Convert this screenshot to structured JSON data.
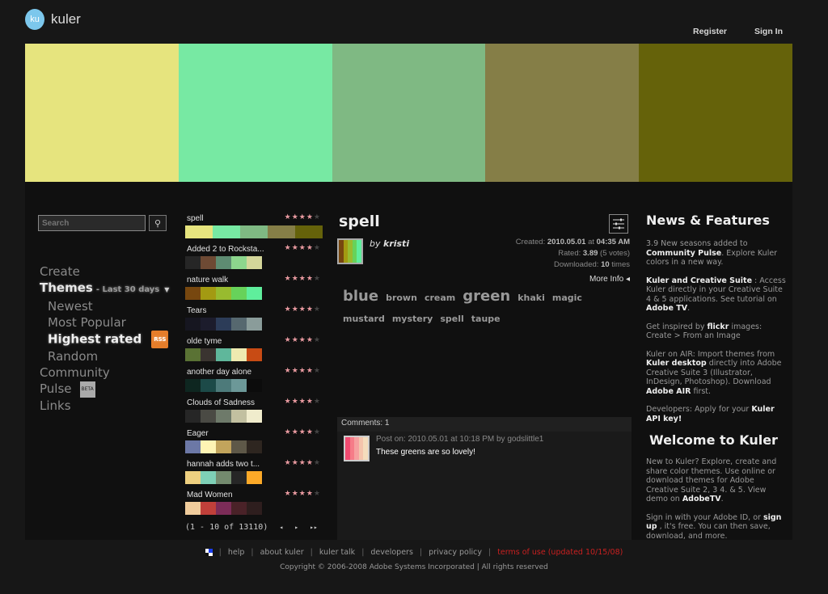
{
  "header": {
    "logo_badge": "ku",
    "logo_text": "kuler",
    "links": [
      "Register",
      "Sign In"
    ]
  },
  "hero": {
    "colors": [
      "#e6e47e",
      "#77e9a3",
      "#7fb983",
      "#857e47",
      "#65620a"
    ]
  },
  "search": {
    "placeholder": "Search",
    "button_icon": "search-advanced-icon"
  },
  "nav": {
    "create": "Create",
    "themes": "Themes",
    "period": "- Last 30 days",
    "sub": [
      "Newest",
      "Most Popular",
      "Highest rated",
      "Random"
    ],
    "rss": "RSS",
    "community": "Community",
    "pulse": "Pulse",
    "beta": "BETA",
    "links": "Links"
  },
  "themes": [
    {
      "name": "spell",
      "rating": 4,
      "colors": [
        "#e6e47e",
        "#77e9a3",
        "#7fb983",
        "#857e47",
        "#65620a"
      ]
    },
    {
      "name": "Added 2 to Rocksta...",
      "rating": 4,
      "colors": [
        "#262626",
        "#6e4a34",
        "#5e8c72",
        "#8dd68d",
        "#d4d69a"
      ]
    },
    {
      "name": "nature walk",
      "rating": 4,
      "colors": [
        "#77470f",
        "#a39a12",
        "#98bb2f",
        "#67d25a",
        "#5fee9c"
      ]
    },
    {
      "name": "Tears",
      "rating": 4,
      "colors": [
        "#161620",
        "#1c1c2c",
        "#2c3c58",
        "#56686f",
        "#8a9c9a"
      ]
    },
    {
      "name": "olde tyme",
      "rating": 4,
      "colors": [
        "#5a7234",
        "#3a3430",
        "#5fb79b",
        "#eeeab0",
        "#c84b14"
      ]
    },
    {
      "name": "another day alone",
      "rating": 4,
      "colors": [
        "#0e2620",
        "#1c4a48",
        "#4d7a7a",
        "#6c9898",
        "#0c0c0c"
      ]
    },
    {
      "name": "Clouds of Sadness",
      "rating": 4,
      "colors": [
        "#262626",
        "#4a4a44",
        "#6e7a6a",
        "#c2c0a0",
        "#f0eccc"
      ]
    },
    {
      "name": "Eager",
      "rating": 4,
      "colors": [
        "#6c78a6",
        "#fef4b4",
        "#c2a45c",
        "#5e5848",
        "#2e2620"
      ]
    },
    {
      "name": "hannah adds two t...",
      "rating": 4,
      "colors": [
        "#eed080",
        "#7ed0b6",
        "#738a6e",
        "#262626",
        "#fca928"
      ]
    },
    {
      "name": "Mad Women",
      "rating": 4,
      "colors": [
        "#f0cc9c",
        "#c0403a",
        "#7c2c58",
        "#4a2228",
        "#2e1e1e"
      ]
    }
  ],
  "pager": {
    "text": "(1 - 10 of 13110)",
    "prev": "◂",
    "next": "▸",
    "last": "▸▸"
  },
  "detail": {
    "title": "spell",
    "by_label": "by",
    "author": "kristi",
    "thumb_colors": [
      "#77470f",
      "#a39a12",
      "#98bb2f",
      "#67d25a",
      "#5fee9c"
    ],
    "created_label": "Created:",
    "created_date": "2010.05.01",
    "at": "at",
    "created_time": "04:35 AM",
    "rated_label": "Rated:",
    "rating": "3.89",
    "votes": "(5 votes)",
    "downloaded_label": "Downloaded:",
    "downloads": "10",
    "times": "times",
    "more_info": "More Info ◂",
    "tags": [
      {
        "text": "blue",
        "big": true
      },
      {
        "text": "brown",
        "big": false
      },
      {
        "text": "cream",
        "big": false
      },
      {
        "text": "green",
        "big": true
      },
      {
        "text": "khaki",
        "big": false
      },
      {
        "text": "magic",
        "big": false
      },
      {
        "text": "mustard",
        "big": false
      },
      {
        "text": "mystery",
        "big": false
      },
      {
        "text": "spell",
        "big": false
      },
      {
        "text": "taupe",
        "big": false
      }
    ]
  },
  "comments": {
    "header": "Comments: 1",
    "items": [
      {
        "meta": "Post on: 2010.05.01 at 10:18 PM by godslittle1",
        "text": "These greens are so lovely!",
        "thumb_colors": [
          "#f04a70",
          "#f67c88",
          "#f6a0a0",
          "#f4c4ac",
          "#f4dcbc"
        ]
      }
    ]
  },
  "news": {
    "title": "News & Features",
    "items": [
      [
        {
          "t": "3.9 New seasons added to "
        },
        {
          "b": "Community Pulse"
        },
        {
          "t": ". Explore Kuler colors in a new way."
        }
      ],
      [
        {
          "b": "Kuler and Creative Suite"
        },
        {
          "t": " : Access Kuler directly in your Creative Suite 4 & 5 applications. See tutorial on "
        },
        {
          "b": "Adobe TV"
        },
        {
          "t": "."
        }
      ],
      [
        {
          "t": "Get inspired by "
        },
        {
          "b": "flickr"
        },
        {
          "t": " images: Create > From an Image"
        }
      ],
      [
        {
          "t": "Kuler on AIR: Import themes from "
        },
        {
          "b": "Kuler desktop"
        },
        {
          "t": " directly into Adobe Creative Suite 3 (Illustrator, InDesign, Photoshop). Download "
        },
        {
          "b": "Adobe AIR"
        },
        {
          "t": " first."
        }
      ],
      [
        {
          "t": "Developers: Apply for your "
        },
        {
          "b": "Kuler API key!"
        }
      ]
    ],
    "welcome_title": "Welcome to Kuler",
    "welcome_items": [
      [
        {
          "t": "New to Kuler? Explore, create and share color themes. Use online or download themes for Adobe Creative Suite 2, 3 4. & 5. View demo on "
        },
        {
          "b": "AdobeTV"
        },
        {
          "t": "."
        }
      ],
      [
        {
          "t": "Sign in with your Adobe ID, or "
        },
        {
          "b": "sign up"
        },
        {
          "t": " , it's free. You can then save, download, and more."
        }
      ]
    ]
  },
  "footer": {
    "links": [
      "help",
      "about kuler",
      "kuler talk",
      "developers",
      "privacy policy"
    ],
    "terms": "terms of use (updated 10/15/08)",
    "copyright": "Copyright © 2006-2008 Adobe Systems Incorporated | All rights reserved"
  }
}
